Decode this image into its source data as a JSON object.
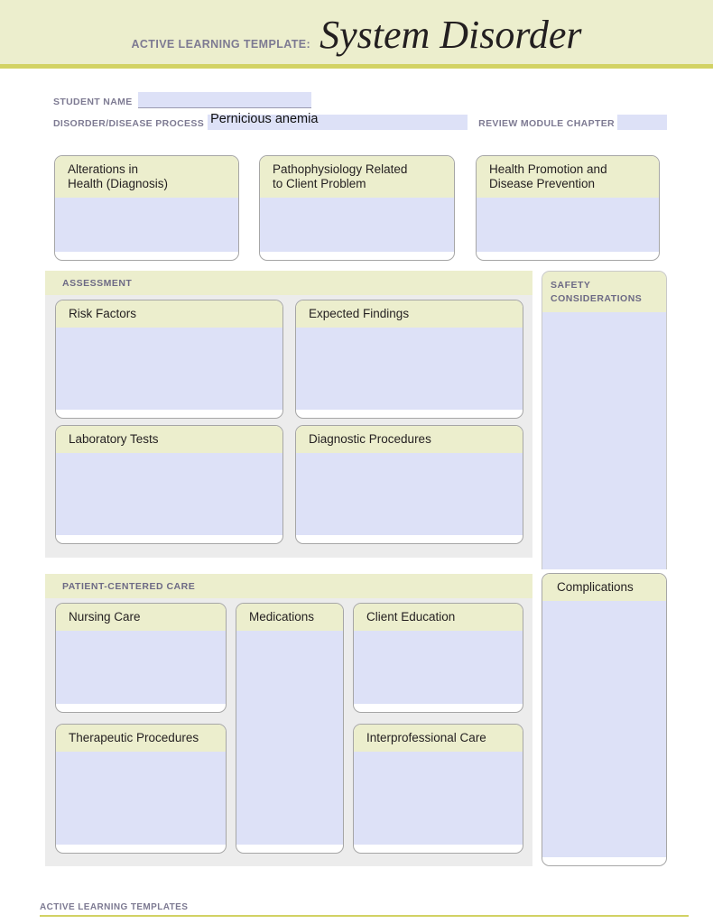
{
  "header": {
    "eyebrow": "ACTIVE LEARNING TEMPLATE:",
    "title": "System Disorder",
    "band_color": "#eceecd",
    "rule_color": "#d2d264"
  },
  "meta": {
    "student_name_label": "STUDENT NAME",
    "student_name_value": "",
    "disorder_label": "DISORDER/DISEASE PROCESS",
    "disorder_value": "Pernicious anemia",
    "chapter_label": "REVIEW MODULE CHAPTER",
    "chapter_value": ""
  },
  "top_cards": [
    {
      "title": "Alterations in\nHealth (Diagnosis)",
      "value": ""
    },
    {
      "title": "Pathophysiology Related\nto Client Problem",
      "value": ""
    },
    {
      "title": "Health Promotion and\nDisease Prevention",
      "value": ""
    }
  ],
  "assessment": {
    "heading": "ASSESSMENT",
    "cards": [
      {
        "title": "Risk Factors",
        "value": ""
      },
      {
        "title": "Expected Findings",
        "value": ""
      },
      {
        "title": "Laboratory Tests",
        "value": ""
      },
      {
        "title": "Diagnostic Procedures",
        "value": ""
      }
    ]
  },
  "patient_centered_care": {
    "heading": "PATIENT-CENTERED CARE",
    "cards": [
      {
        "title": "Nursing Care",
        "value": ""
      },
      {
        "title": "Medications",
        "value": ""
      },
      {
        "title": "Client Education",
        "value": ""
      },
      {
        "title": "Therapeutic Procedures",
        "value": ""
      },
      {
        "title": "Interprofessional Care",
        "value": ""
      }
    ]
  },
  "safety": {
    "heading": "SAFETY\nCONSIDERATIONS",
    "value": ""
  },
  "complications": {
    "title": "Complications",
    "value": ""
  },
  "footer": {
    "label": "ACTIVE LEARNING TEMPLATES"
  },
  "colors": {
    "field_blue": "#dde1f7",
    "header_yellow": "#eceecd",
    "panel_gray": "#ececec",
    "label_purple": "#7d7a92",
    "accent_olive": "#d2d264"
  }
}
